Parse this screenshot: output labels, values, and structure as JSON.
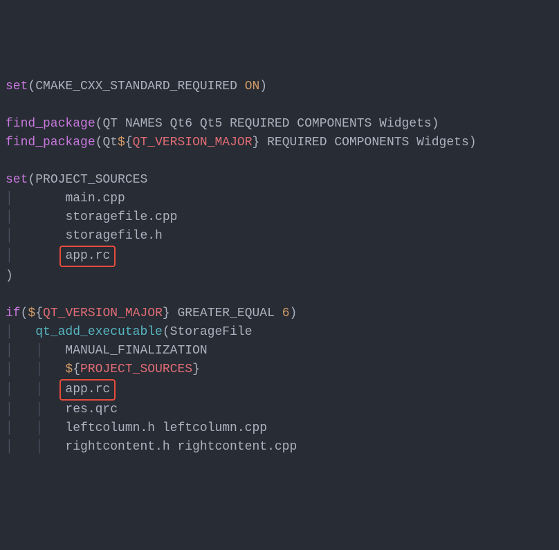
{
  "line1": {
    "set": "set",
    "arg1": "CMAKE_CXX_STANDARD_REQUIRED",
    "on": "ON"
  },
  "line3": {
    "find": "find_package",
    "args": "QT NAMES Qt6 Qt5 REQUIRED COMPONENTS Widgets"
  },
  "line4": {
    "find": "find_package",
    "qt": "Qt",
    "var": "QT_VERSION_MAJOR",
    "rest": " REQUIRED COMPONENTS Widgets"
  },
  "line6": {
    "set": "set",
    "proj": "PROJECT_SOURCES"
  },
  "src1": "main.cpp",
  "src2": "storagefile.cpp",
  "src3": "storagefile.h",
  "src4": "app.rc",
  "line12": {
    "if": "if",
    "var": "QT_VERSION_MAJOR",
    "ge": " GREATER_EQUAL ",
    "six": "6"
  },
  "line13": {
    "fn": "qt_add_executable",
    "tgt": "StorageFile"
  },
  "line14": "MANUAL_FINALIZATION",
  "line15": {
    "var": "PROJECT_SOURCES"
  },
  "line16": "app.rc",
  "line17": "res.qrc",
  "line18": "leftcolumn.h leftcolumn.cpp",
  "line19": "rightcontent.h rightcontent.cpp"
}
